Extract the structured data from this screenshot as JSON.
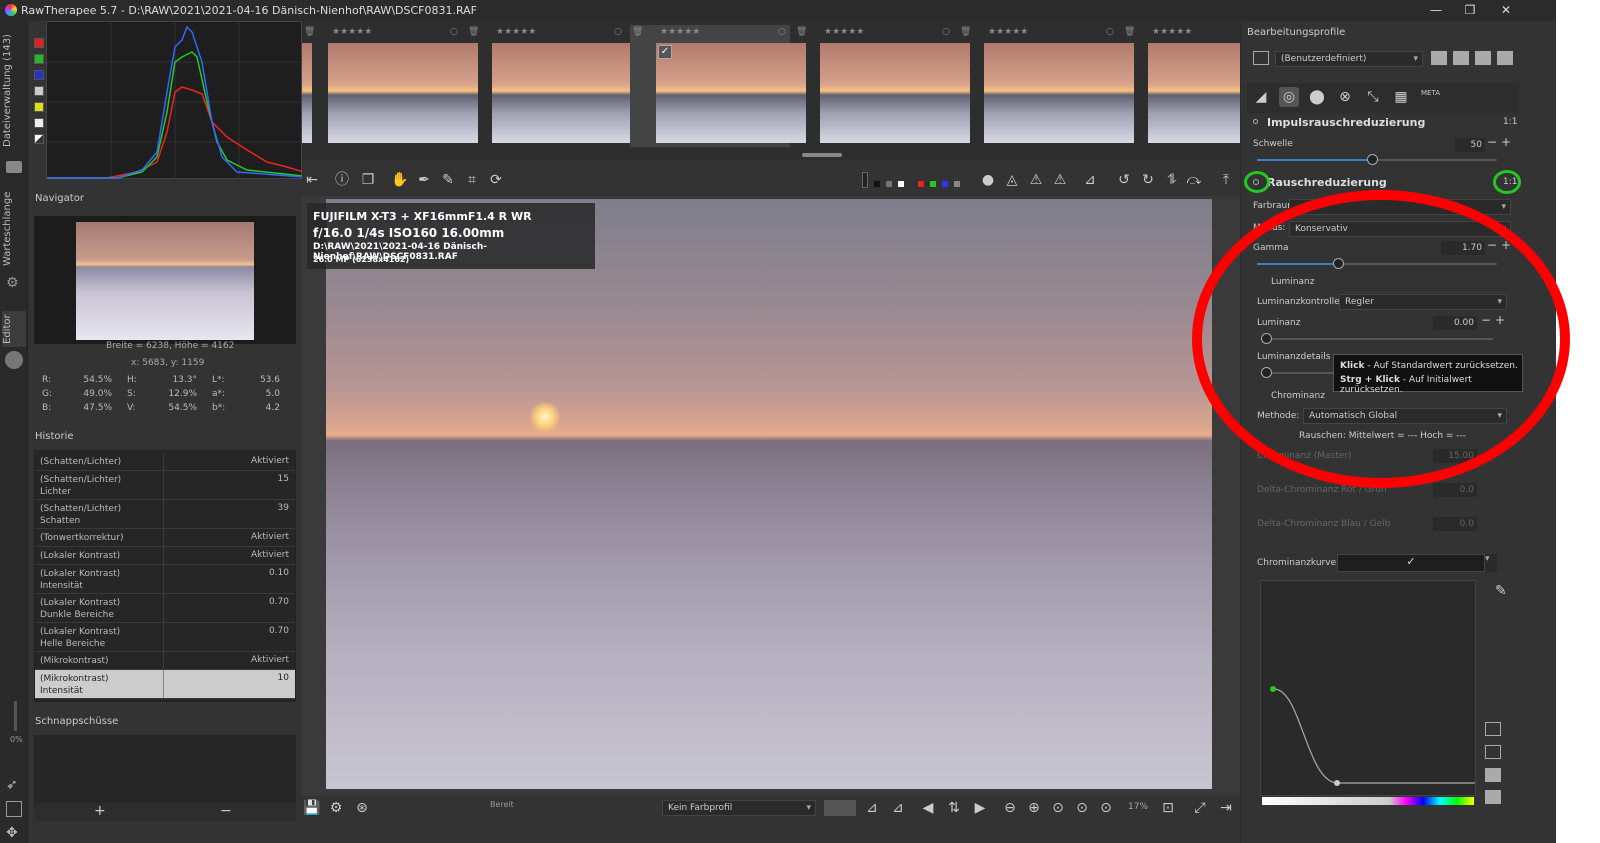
{
  "window": {
    "title": "RawTherapee 5.7 - D:\\RAW\\2021\\2021-04-16 Dänisch-Nienhof\\RAW\\DSCF0831.RAF",
    "min": "—",
    "max": "❐",
    "close": "✕"
  },
  "left_tabs": {
    "dateiverwaltung": "Dateiverwaltung (143)",
    "warteschlange": "Warteschlange",
    "editor": "Editor"
  },
  "navigator": {
    "title": "Navigator",
    "size_text": "Breite = 6238, Höhe = 4162",
    "coords_text": "x: 5683, y: 1159",
    "rgb": [
      {
        "k": "R:",
        "v": "54.5%"
      },
      {
        "k": "G:",
        "v": "49.0%"
      },
      {
        "k": "B:",
        "v": "47.5%"
      }
    ],
    "hsv": [
      {
        "k": "H:",
        "v": "13.3°"
      },
      {
        "k": "S:",
        "v": "12.9%"
      },
      {
        "k": "V:",
        "v": "54.5%"
      }
    ],
    "lab": [
      {
        "k": "L*:",
        "v": "53.6"
      },
      {
        "k": "a*:",
        "v": "5.0"
      },
      {
        "k": "b*:",
        "v": "4.2"
      }
    ]
  },
  "history": {
    "title": "Historie",
    "rows": [
      {
        "l": "(Schatten/Lichter)",
        "r": "Aktiviert"
      },
      {
        "l": "(Schatten/Lichter)\nLichter",
        "r": "15"
      },
      {
        "l": "(Schatten/Lichter)\nSchatten",
        "r": "39"
      },
      {
        "l": "(Tonwertkorrektur)",
        "r": "Aktiviert"
      },
      {
        "l": "(Lokaler Kontrast)",
        "r": "Aktiviert"
      },
      {
        "l": "(Lokaler Kontrast)\nIntensität",
        "r": "0.10"
      },
      {
        "l": "(Lokaler Kontrast)\nDunkle Bereiche",
        "r": "0.70"
      },
      {
        "l": "(Lokaler Kontrast)\nHelle Bereiche",
        "r": "0.70"
      },
      {
        "l": "(Mikrokontrast)",
        "r": "Aktiviert"
      },
      {
        "l": "(Mikrokontrast)\nIntensität",
        "r": "10"
      }
    ]
  },
  "snapshots": {
    "title": "Schnappschüsse",
    "add": "+",
    "remove": "−"
  },
  "zoom_left": "0%",
  "exif": {
    "line1": "FUJIFILM X-T3 + XF16mmF1.4 R WR",
    "line2": "f/16.0  1/4s  ISO160  16.00mm",
    "line3": "D:\\RAW\\2021\\2021-04-16 Dänisch-Nienhof\\RAW\\DSCF0831.RAF",
    "line4": "26.0 MP (6238x4162)"
  },
  "bottom": {
    "status": "Bereit",
    "profile": "Kein Farbprofil",
    "zoom": "17%"
  },
  "right": {
    "profiles_title": "Bearbeitungsprofile",
    "profile_value": "(Benutzerdefiniert)",
    "tab_meta": "META",
    "impulse_title": "Impulsrauschreduzierung",
    "impulse_ratio": "1:1",
    "schwelle_label": "Schwelle",
    "schwelle_value": "50",
    "noise_title": "Rauschreduzierung",
    "noise_ratio": "1:1",
    "farbraum_label": "Farbraum:",
    "modus_label": "Modus:",
    "modus_value": "Konservativ",
    "gamma_label": "Gamma",
    "gamma_value": "1.70",
    "luminanz_section": "Luminanz",
    "lumkontrolle_label": "Luminanzkontrolle:",
    "lumkontrolle_value": "Regler",
    "luminanz_label": "Luminanz",
    "luminanz_value": "0.00",
    "lumdetails_label": "Luminanzdetails",
    "chrominanz_section": "Chrominanz",
    "methode_label": "Methode:",
    "methode_value": "Automatisch Global",
    "rauschen_text": "Rauschen: Mittelwert = ---   Hoch = ---",
    "master_label": "Chrominanz (Master)",
    "master_value": "15.00",
    "rotgrun_label": "Delta-Chrominanz Rot / Grün",
    "rotgrun_value": "0.0",
    "blaugelb_label": "Delta-Chrominanz Blau / Gelb",
    "blaugelb_value": "0.0",
    "kurve_label": "Chrominanzkurve:",
    "pm_minus": "−",
    "pm_plus": "+"
  },
  "tooltip": {
    "line1_bold": "Klick",
    "line1": " - Auf Standardwert zurücksetzen.",
    "line2_bold": "Strg + Klick",
    "line2": " - Auf Initialwert zurücksetzen."
  },
  "colors": {
    "annotation_red": "#ff0000",
    "annotation_green": "#22c922",
    "accent_blue": "#3a7fc2"
  }
}
